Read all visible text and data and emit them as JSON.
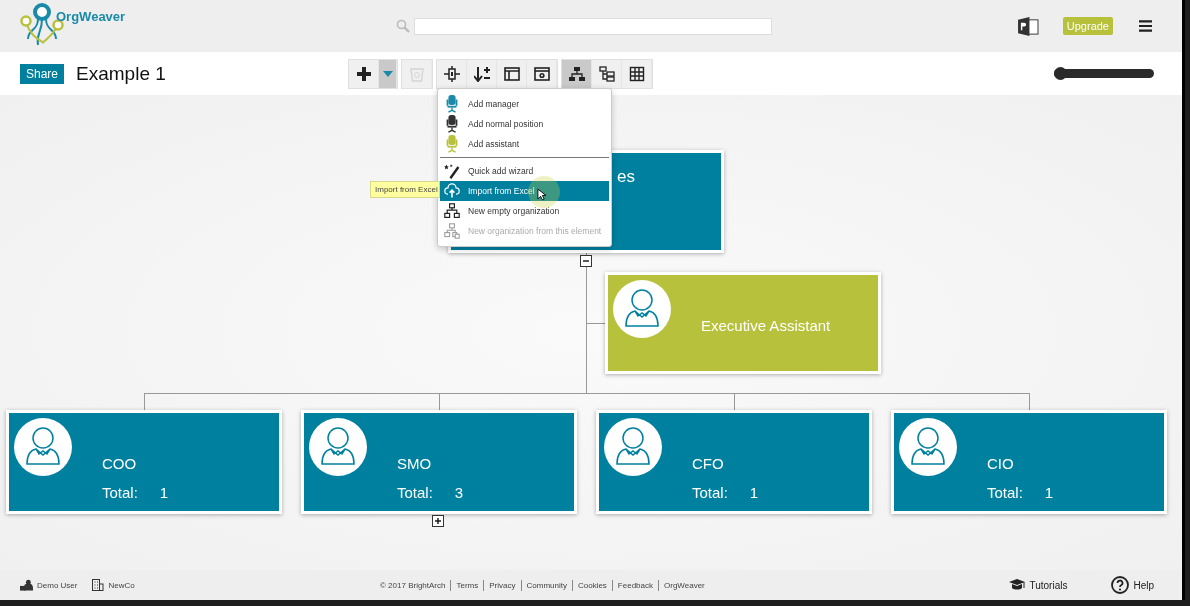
{
  "header": {
    "logo_text": "OrgWeaver",
    "upgrade": "Upgrade"
  },
  "toolbar": {
    "share": "Share",
    "title": "Example 1",
    "groups": [
      {
        "tools": [
          {
            "kind": "add",
            "selected": false,
            "disabled": false
          },
          {
            "kind": "dropdown",
            "selected": true,
            "disabled": false
          }
        ]
      },
      {
        "tools": [
          {
            "kind": "delete",
            "selected": false,
            "disabled": true
          }
        ]
      },
      {
        "tools": [
          {
            "kind": "fit",
            "selected": false,
            "disabled": false
          },
          {
            "kind": "sort",
            "selected": false,
            "disabled": false
          },
          {
            "kind": "panel",
            "selected": false,
            "disabled": false
          },
          {
            "kind": "settings",
            "selected": false,
            "disabled": false
          }
        ]
      },
      {
        "tools": [
          {
            "kind": "chart",
            "selected": true,
            "disabled": false
          },
          {
            "kind": "tree",
            "selected": false,
            "disabled": false
          },
          {
            "kind": "grid",
            "selected": false,
            "disabled": false
          }
        ]
      }
    ],
    "zoom": {
      "level": 0
    }
  },
  "menu": {
    "groups": [
      {
        "items": [
          {
            "kind": "manager",
            "label": "Add manager",
            "selected": false,
            "disabled": false
          },
          {
            "kind": "normal",
            "label": "Add normal position",
            "selected": false,
            "disabled": false
          },
          {
            "kind": "assistant",
            "label": "Add assistant",
            "selected": false,
            "disabled": false
          }
        ]
      },
      {
        "items": [
          {
            "kind": "wizard",
            "label": "Quick add wizard",
            "selected": false,
            "disabled": false
          },
          {
            "kind": "excel",
            "label": "Import from Excel",
            "selected": true,
            "disabled": false
          },
          {
            "kind": "org",
            "label": "New empty organization",
            "selected": false,
            "disabled": false
          },
          {
            "kind": "org-copy",
            "label": "New organization from this element",
            "selected": false,
            "disabled": true
          }
        ]
      }
    ]
  },
  "tooltip": "Import from Excel",
  "chart": {
    "root": {
      "title": "es",
      "expanded": true
    },
    "assistant": {
      "title": "Executive Assistant"
    },
    "children": [
      {
        "title": "COO",
        "total_label": "Total:",
        "total": "1"
      },
      {
        "title": "SMO",
        "total_label": "Total:",
        "total": "3",
        "expanded": false
      },
      {
        "title": "CFO",
        "total_label": "Total:",
        "total": "1"
      },
      {
        "title": "CIO",
        "total_label": "Total:",
        "total": "1"
      }
    ]
  },
  "footer": {
    "user": "Demo User",
    "company": "NewCo",
    "links": [
      "© 2017 BrightArch",
      "Terms",
      "Privacy",
      "Community",
      "Cookies",
      "Feedback",
      "OrgWeaver"
    ],
    "tutorials": "Tutorials",
    "help": "Help"
  }
}
